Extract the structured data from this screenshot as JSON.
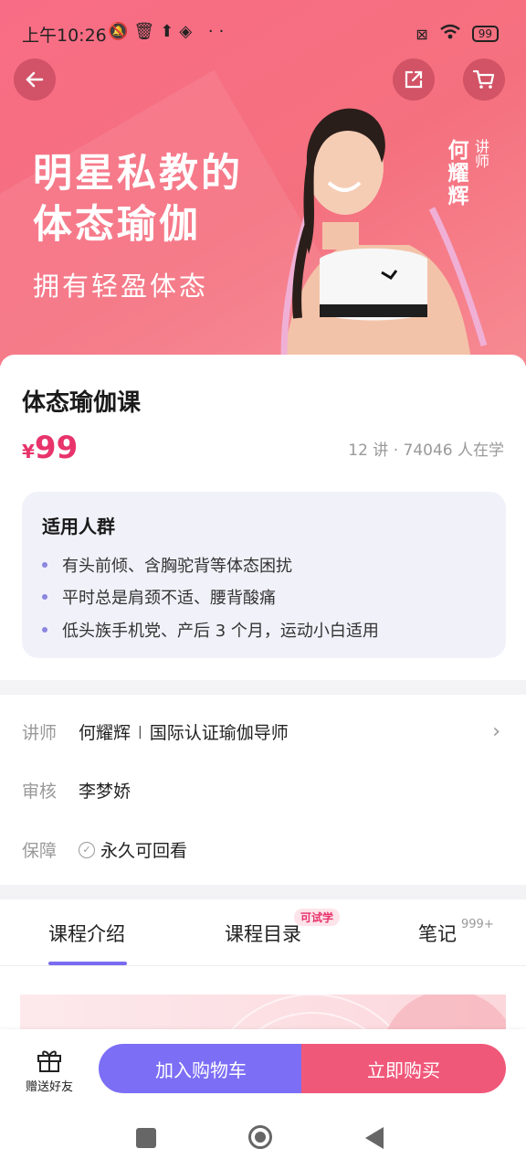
{
  "status_bar": {
    "time": "上午10:26",
    "battery": "99"
  },
  "hero": {
    "title_line1": "明星私教的",
    "title_line2": "体态瑜伽",
    "subtitle": "拥有轻盈体态",
    "instructor_name": "何耀辉",
    "instructor_role": "讲师"
  },
  "course": {
    "title": "体态瑜伽课",
    "currency": "¥",
    "price": "99",
    "meta": "12 讲 · 74046 人在学"
  },
  "audience": {
    "title": "适用人群",
    "items": [
      "有头前倾、含胸驼背等体态困扰",
      "平时总是肩颈不适、腰背酸痛",
      "低头族手机党、产后 3 个月，运动小白适用"
    ]
  },
  "info": {
    "instructor_label": "讲师",
    "instructor_name": "何耀辉",
    "instructor_sep": "|",
    "instructor_title": "国际认证瑜伽导师",
    "reviewer_label": "审核",
    "reviewer_name": "李梦娇",
    "guarantee_label": "保障",
    "guarantee_text": "永久可回看"
  },
  "tabs": {
    "intro": "课程介绍",
    "catalog": "课程目录",
    "catalog_badge": "可试学",
    "notes": "笔记",
    "notes_count": "999+"
  },
  "bottom": {
    "gift_label": "赠送好友",
    "add_cart": "加入购物车",
    "buy_now": "立即购买"
  },
  "colors": {
    "hero": "#f5707f",
    "price": "#e8336b",
    "cart_button": "#7c6ef5",
    "buy_button": "#f0587a",
    "tab_underline": "#7a6cf0"
  }
}
